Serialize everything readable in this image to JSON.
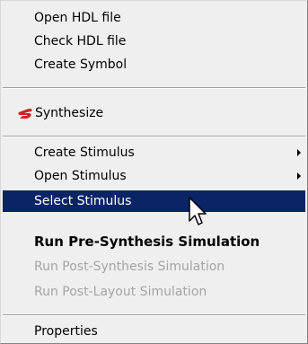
{
  "menu": {
    "items": [
      {
        "label": "Open HDL file"
      },
      {
        "label": "Check HDL file"
      },
      {
        "label": "Create Symbol"
      },
      {
        "label": "Synthesize",
        "icon": "synplify-s-icon",
        "icon_color": "#cc2222"
      },
      {
        "label": "Create Stimulus",
        "submenu": true
      },
      {
        "label": "Open Stimulus",
        "submenu": true
      },
      {
        "label": "Select Stimulus",
        "state": "highlighted"
      },
      {
        "label": "Run Pre-Synthesis Simulation",
        "style": "bold"
      },
      {
        "label": "Run Post-Synthesis Simulation",
        "state": "disabled"
      },
      {
        "label": "Run Post-Layout Simulation",
        "state": "disabled"
      },
      {
        "label": "Properties"
      }
    ]
  },
  "cursor": {
    "icon": "arrow-pointer-icon"
  },
  "colors": {
    "menu_background": "#efefef",
    "highlight": "#0b2466",
    "highlight_text": "#ffffff",
    "disabled_text": "#a4a4a4"
  }
}
